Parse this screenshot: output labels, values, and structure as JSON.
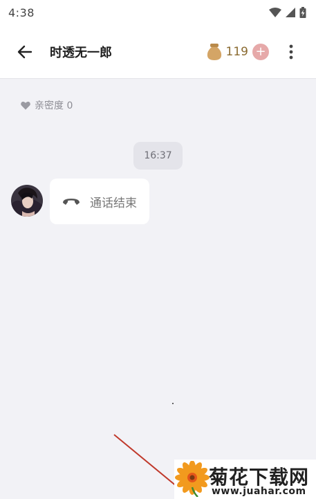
{
  "status_bar": {
    "time": "4:38",
    "icons": [
      "wifi-icon",
      "signal-icon",
      "battery-charging-icon"
    ]
  },
  "header": {
    "title": "时透无一郎",
    "coin_count": "119",
    "add_coin_label": "+",
    "icons": [
      "back-arrow-icon",
      "coin-bag-icon",
      "more-vertical-icon"
    ]
  },
  "chat": {
    "intimacy_label": "亲密度 0",
    "time_badge": "16:37",
    "messages": [
      {
        "type": "call",
        "icon": "hangup-phone-icon",
        "text": "通话结束"
      }
    ]
  },
  "watermark": {
    "title": "菊花下载网",
    "url": "www.juahar.com"
  },
  "colors": {
    "background": "#f2f2f6",
    "header_bg": "#ffffff",
    "coin_text": "#8a6a30",
    "add_coin_bg": "#e6a9a9",
    "watermark_line": "#c0392b"
  }
}
